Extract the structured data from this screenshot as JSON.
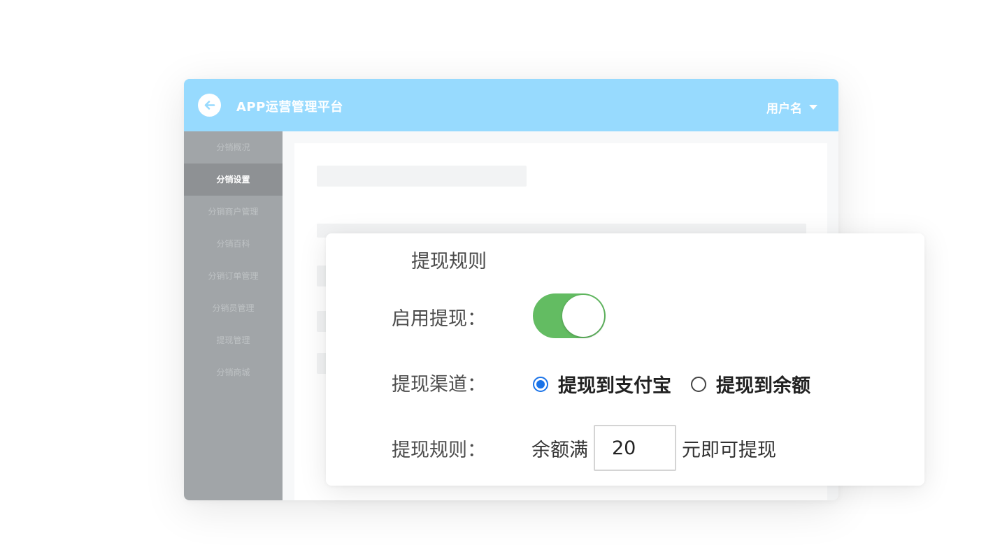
{
  "header": {
    "app_title": "APP运营管理平台",
    "user_name": "用户名"
  },
  "icons": {
    "back": "arrow-left-circle-icon",
    "user_caret": "caret-down-icon"
  },
  "colors": {
    "topbar": "#97dafe",
    "sidebar": "#a1a5a8",
    "sidebar_active": "#8e9194",
    "toggle_on": "#63bc62",
    "radio_checked": "#1a73e8"
  },
  "sidebar": {
    "items": [
      {
        "label": "分销概况",
        "active": false
      },
      {
        "label": "分销设置",
        "active": true
      },
      {
        "label": "分销商户管理",
        "active": false
      },
      {
        "label": "分销百科",
        "active": false
      },
      {
        "label": "分销订单管理",
        "active": false
      },
      {
        "label": "分销员管理",
        "active": false
      },
      {
        "label": "提现管理",
        "active": false
      },
      {
        "label": "分销商城",
        "active": false
      }
    ]
  },
  "withdraw_card": {
    "title": "提现规则",
    "enable": {
      "label": "启用提现：",
      "on": true
    },
    "channel": {
      "label": "提现渠道：",
      "options": [
        {
          "label": "提现到支付宝",
          "checked": true
        },
        {
          "label": "提现到余额",
          "checked": false
        }
      ]
    },
    "rule": {
      "label": "提现规则：",
      "prefix": "余额满",
      "amount": "20",
      "suffix": "元即可提现"
    }
  }
}
